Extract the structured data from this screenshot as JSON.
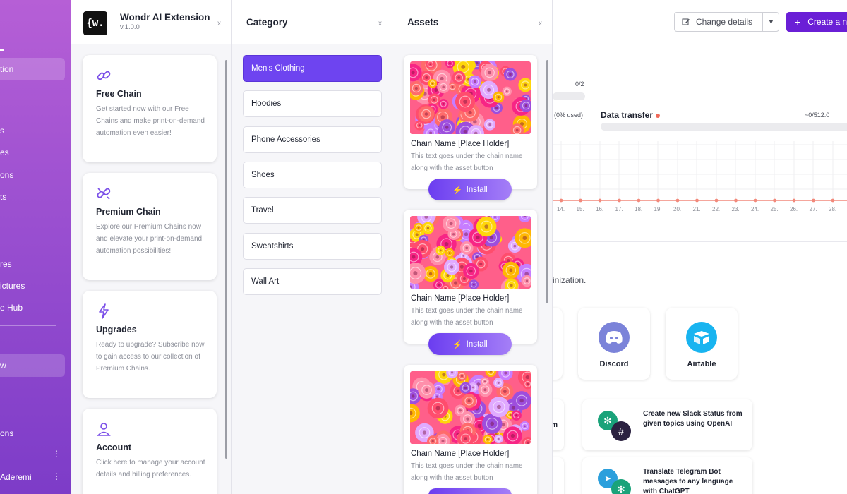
{
  "extension": {
    "logo_text": "{w.",
    "name": "Wondr AI Extension",
    "version": "v.1.0.0",
    "close": "x",
    "features": [
      {
        "title": "Free Chain",
        "description": "Get started now with our Free Chains and make print-on-demand automation even easier!",
        "icon": "link-icon"
      },
      {
        "title": "Premium Chain",
        "description": "Explore our Premium Chains now and elevate your print-on-demand automation possibilities!",
        "icon": "broken-link-icon"
      },
      {
        "title": "Upgrades",
        "description": "Ready to upgrade? Subscribe now to gain access to our collection of Premium Chains.",
        "icon": "lightning-icon"
      },
      {
        "title": "Account",
        "description": "Click here to manage your account details and billing preferences.",
        "icon": "user-icon"
      }
    ]
  },
  "category": {
    "title": "Category",
    "close": "x",
    "items": [
      "Men's Clothing",
      "Hoodies",
      "Phone Accessories",
      "Shoes",
      "Travel",
      "Sweatshirts",
      "Wall Art"
    ],
    "selected": "Men's Clothing"
  },
  "assets": {
    "title": "Assets",
    "close": "x",
    "items": [
      {
        "name": "Chain Name [Place Holder]",
        "description": "This text goes under the chain name along with the asset button",
        "button": "Install"
      },
      {
        "name": "Chain Name [Place Holder]",
        "description": "This text goes under the chain name along with the asset button",
        "button": "Install"
      },
      {
        "name": "Chain Name [Place Holder]",
        "description": "This text goes under the chain name along with the asset button",
        "button": "Install"
      }
    ]
  },
  "background_sidebar": {
    "items": [
      "tion",
      "s",
      "es",
      "ons",
      "ts",
      "res",
      "ictures",
      "e Hub",
      "w",
      "ons",
      "Aderemi"
    ]
  },
  "background_main": {
    "change_details": "Change details",
    "create": "Create a n",
    "usage_count": "0/2",
    "usage_used": "(0% used)",
    "data_transfer_label": "Data transfer",
    "data_transfer_value": "~0/512.0",
    "chart_ticks": [
      "14.",
      "15.",
      "16.",
      "17.",
      "18.",
      "19.",
      "20.",
      "21.",
      "22.",
      "23.",
      "24.",
      "25.",
      "26.",
      "27.",
      "28."
    ],
    "org_text": "inization.",
    "apps": [
      {
        "name": "Discord",
        "color": "#7b83d9"
      },
      {
        "name": "Airtable",
        "color": "#18b4f0"
      }
    ],
    "partial_flow_text": "om",
    "flows": [
      {
        "text": "Create new Slack Status from given topics using OpenAI"
      },
      {
        "text": "Translate Telegram Bot messages to any language with ChatGPT"
      }
    ]
  },
  "colors": {
    "accent": "#6e44f0",
    "sidebar_gradient_top": "#b65fd6",
    "sidebar_gradient_bottom": "#7d3cc8",
    "create_button": "#6a1fd6",
    "data_dot": "#f06a5a"
  }
}
